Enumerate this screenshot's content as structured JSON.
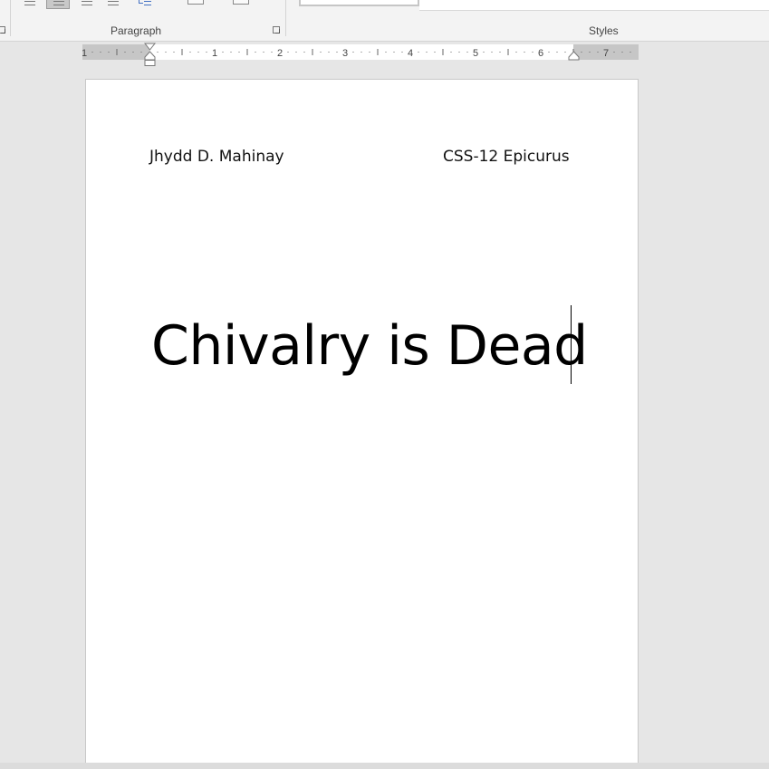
{
  "ribbon": {
    "paragraph_label": "Paragraph",
    "styles_label": "Styles",
    "selected_alignment": "align-left"
  },
  "ruler": {
    "unit": "inches",
    "left_numbers": [
      "1"
    ],
    "numbers": [
      "1",
      "2",
      "3",
      "4",
      "5",
      "6",
      "7"
    ]
  },
  "document": {
    "header_left": "Jhydd D. Mahinay",
    "header_right": "CSS-12 Epicurus",
    "title": "Chivalry is Dead"
  },
  "colors": {
    "workspace": "#e6e6e6",
    "ribbon": "#f3f3f3",
    "page": "#ffffff",
    "accent": "#4472c4"
  }
}
